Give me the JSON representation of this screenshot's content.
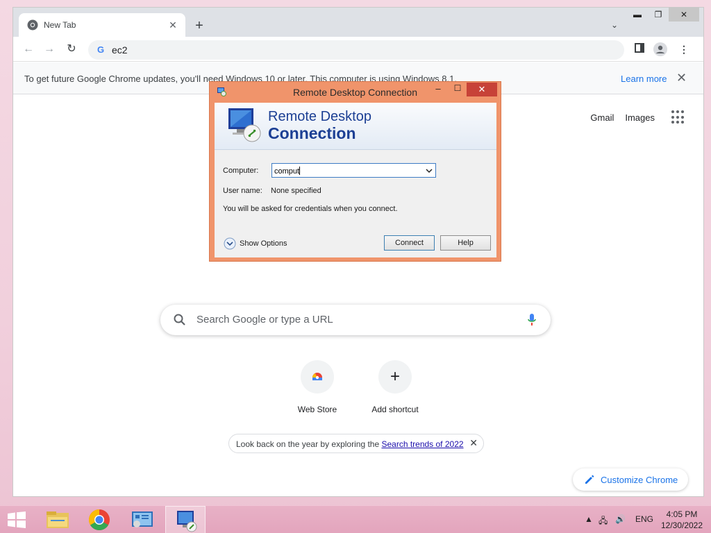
{
  "browser": {
    "tab_title": "New Tab",
    "address": "ec2",
    "infobar": {
      "message": "To get future Google Chrome updates, you'll need Windows 10 or later. This computer is using Windows 8.1.",
      "link": "Learn more"
    }
  },
  "newtab": {
    "links": [
      "Gmail",
      "Images"
    ],
    "search_placeholder": "Search Google or type a URL",
    "shortcuts": [
      {
        "label": "Web Store"
      },
      {
        "label": "Add shortcut"
      }
    ],
    "trends": {
      "prefix": "Look back on the year by exploring the ",
      "link": "Search trends of 2022"
    },
    "customize_label": "Customize Chrome"
  },
  "rdp": {
    "window_title": "Remote Desktop Connection",
    "banner_line1": "Remote Desktop",
    "banner_line2": "Connection",
    "computer_label": "Computer:",
    "computer_value": "comput",
    "username_label": "User name:",
    "username_value": "None specified",
    "note": "You will be asked for credentials when you connect.",
    "show_options": "Show Options",
    "connect_label": "Connect",
    "help_label": "Help"
  },
  "taskbar": {
    "language": "ENG",
    "time": "4:05 PM",
    "date": "12/30/2022"
  },
  "colors": {
    "rdp_frame": "#f0946b",
    "rdp_close": "#c74238",
    "link_blue": "#1a73e8",
    "taskbar": "#e3a5bd"
  }
}
